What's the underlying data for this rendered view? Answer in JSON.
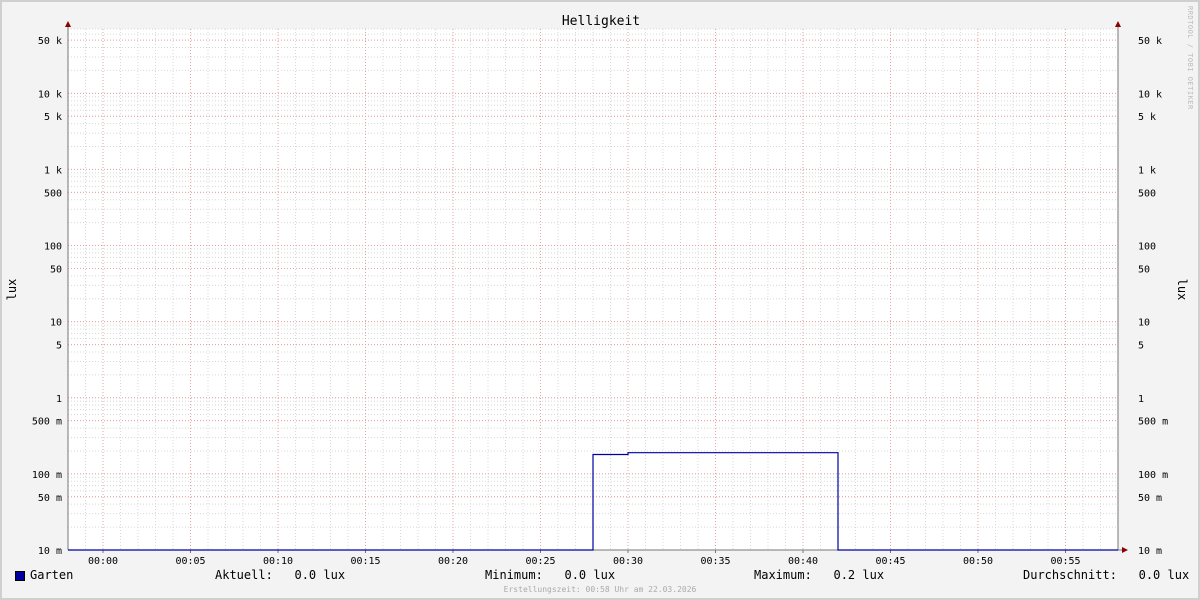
{
  "chart_data": {
    "type": "line",
    "title": "Helligkeit",
    "ylabel": "lux",
    "ylabel_right": "lux",
    "yscale": "log",
    "ylim": [
      0.01,
      70000
    ],
    "xlim": [
      "23:58",
      "00:58"
    ],
    "y_ticks": [
      {
        "value": 50000,
        "label": "50 k"
      },
      {
        "value": 10000,
        "label": "10 k"
      },
      {
        "value": 5000,
        "label": "5 k"
      },
      {
        "value": 1000,
        "label": "1 k"
      },
      {
        "value": 500,
        "label": "500"
      },
      {
        "value": 100,
        "label": "100"
      },
      {
        "value": 50,
        "label": "50"
      },
      {
        "value": 10,
        "label": "10"
      },
      {
        "value": 5,
        "label": "5"
      },
      {
        "value": 1,
        "label": "1"
      },
      {
        "value": 0.5,
        "label": "500 m"
      },
      {
        "value": 0.1,
        "label": "100 m"
      },
      {
        "value": 0.05,
        "label": "50 m"
      },
      {
        "value": 0.01,
        "label": "10 m"
      }
    ],
    "x_ticks": [
      "00:00",
      "00:05",
      "00:10",
      "00:15",
      "00:20",
      "00:25",
      "00:30",
      "00:35",
      "00:40",
      "00:45",
      "00:50",
      "00:55"
    ],
    "series": [
      {
        "name": "Garten",
        "color": "#0000a0",
        "points": [
          {
            "x": "23:58",
            "y": 0
          },
          {
            "x": "00:28",
            "y": 0
          },
          {
            "x": "00:28",
            "y": 0.18
          },
          {
            "x": "00:30",
            "y": 0.18
          },
          {
            "x": "00:30",
            "y": 0.19
          },
          {
            "x": "00:42",
            "y": 0.19
          },
          {
            "x": "00:42",
            "y": 0
          },
          {
            "x": "00:58",
            "y": 0
          }
        ]
      }
    ],
    "grid": true,
    "legend_position": "bottom"
  },
  "legend": {
    "series_name": "Garten",
    "aktuell": "Aktuell:   0.0 lux",
    "minimum": "Minimum:   0.0 lux",
    "maximum": "Maximum:   0.2 lux",
    "durchschnitt": "Durchschnitt:   0.0 lux"
  },
  "footer": "Erstellungszeit: 00:58 Uhr am 22.03.2026",
  "watermark": "RRDTOOL / TOBI OETIKER",
  "colors": {
    "background": "#f3f3f3",
    "plot_background": "#ffffff",
    "minor_grid": "#d8d8d8",
    "major_grid": "#e8a0a0",
    "series": "#0000a0",
    "axis_arrow": "#8b0000"
  }
}
